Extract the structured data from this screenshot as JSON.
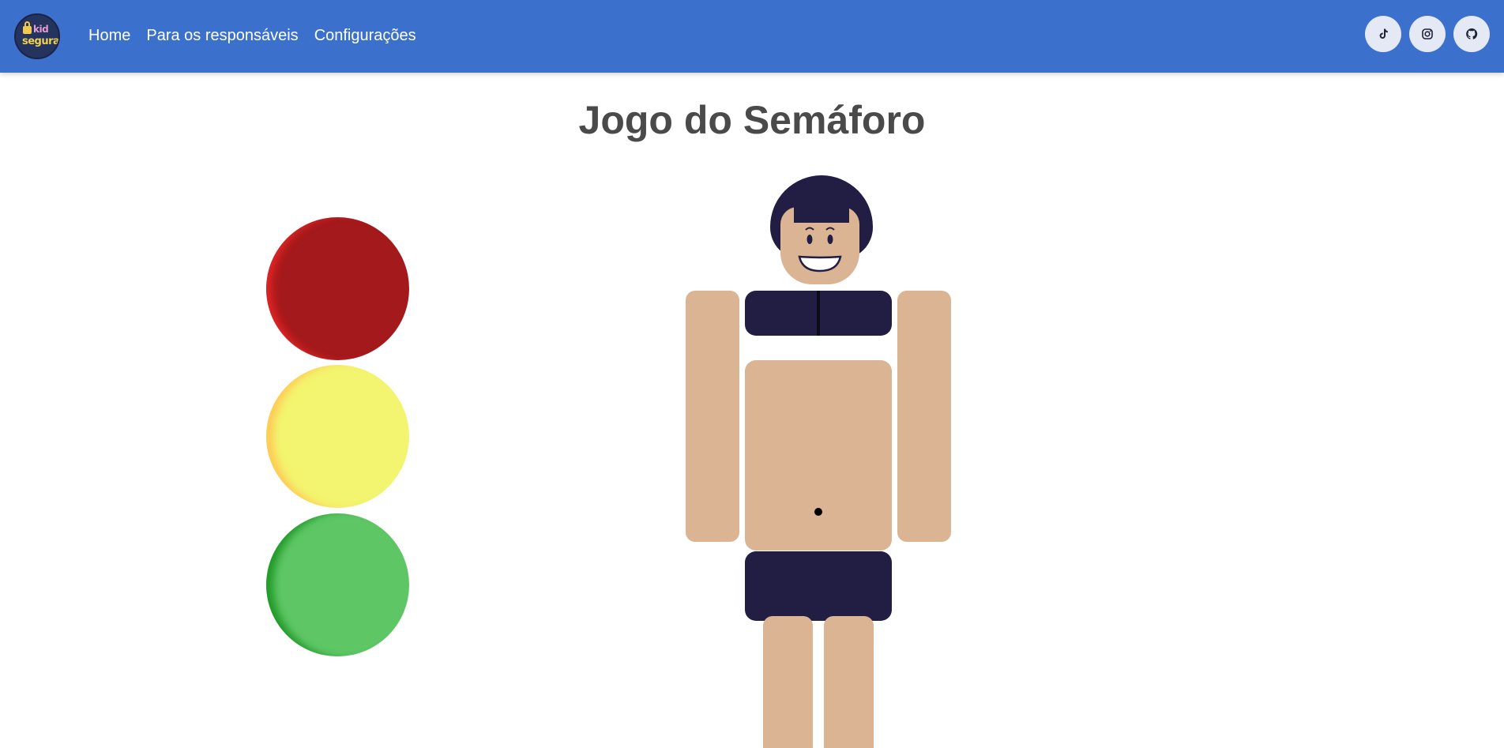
{
  "navbar": {
    "logo": {
      "line1": "kid",
      "line2": "segura",
      "icon": "lock-icon"
    },
    "links": [
      "Home",
      "Para os responsáveis",
      "Configurações"
    ],
    "socials": [
      "tiktok-icon",
      "instagram-icon",
      "github-icon"
    ]
  },
  "page": {
    "title": "Jogo do Semáforo"
  },
  "traffic_light": {
    "lights": [
      {
        "color": "red",
        "hex": "#a3191c"
      },
      {
        "color": "yellow",
        "hex": "#f3f46f"
      },
      {
        "color": "green",
        "hex": "#5ec665"
      }
    ]
  },
  "colors": {
    "navbar": "#3b71cd",
    "skin": "#dbb494",
    "clothing": "#221d42",
    "title": "#4a4a4a"
  }
}
